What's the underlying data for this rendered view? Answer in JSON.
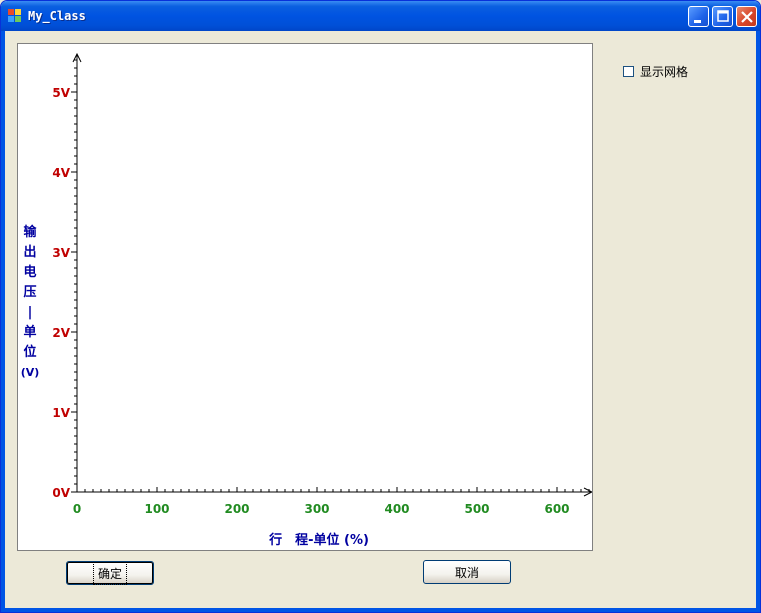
{
  "window": {
    "title": "My_Class"
  },
  "chart_data": {
    "type": "line",
    "series": [],
    "x_ticks": [
      "0",
      "100",
      "200",
      "300",
      "400",
      "500",
      "600"
    ],
    "y_ticks": [
      "0V",
      "1V",
      "2V",
      "3V",
      "4V",
      "5V"
    ],
    "xlabel": "行　程-单位 (%)",
    "ylabel_chars": [
      "输",
      "出",
      "电",
      "压",
      "|",
      "单",
      "位",
      "(V)"
    ],
    "xlim": [
      0,
      640
    ],
    "ylim": [
      0,
      5.5
    ],
    "grid": false,
    "colors": {
      "x_tick_color": "#218b21",
      "y_tick_color": "#c00000",
      "label_color": "#0000a0",
      "axis_color": "#000000"
    }
  },
  "controls": {
    "grid_checkbox_label": "显示网格",
    "grid_checked": false,
    "ok_label": "确定",
    "cancel_label": "取消"
  }
}
